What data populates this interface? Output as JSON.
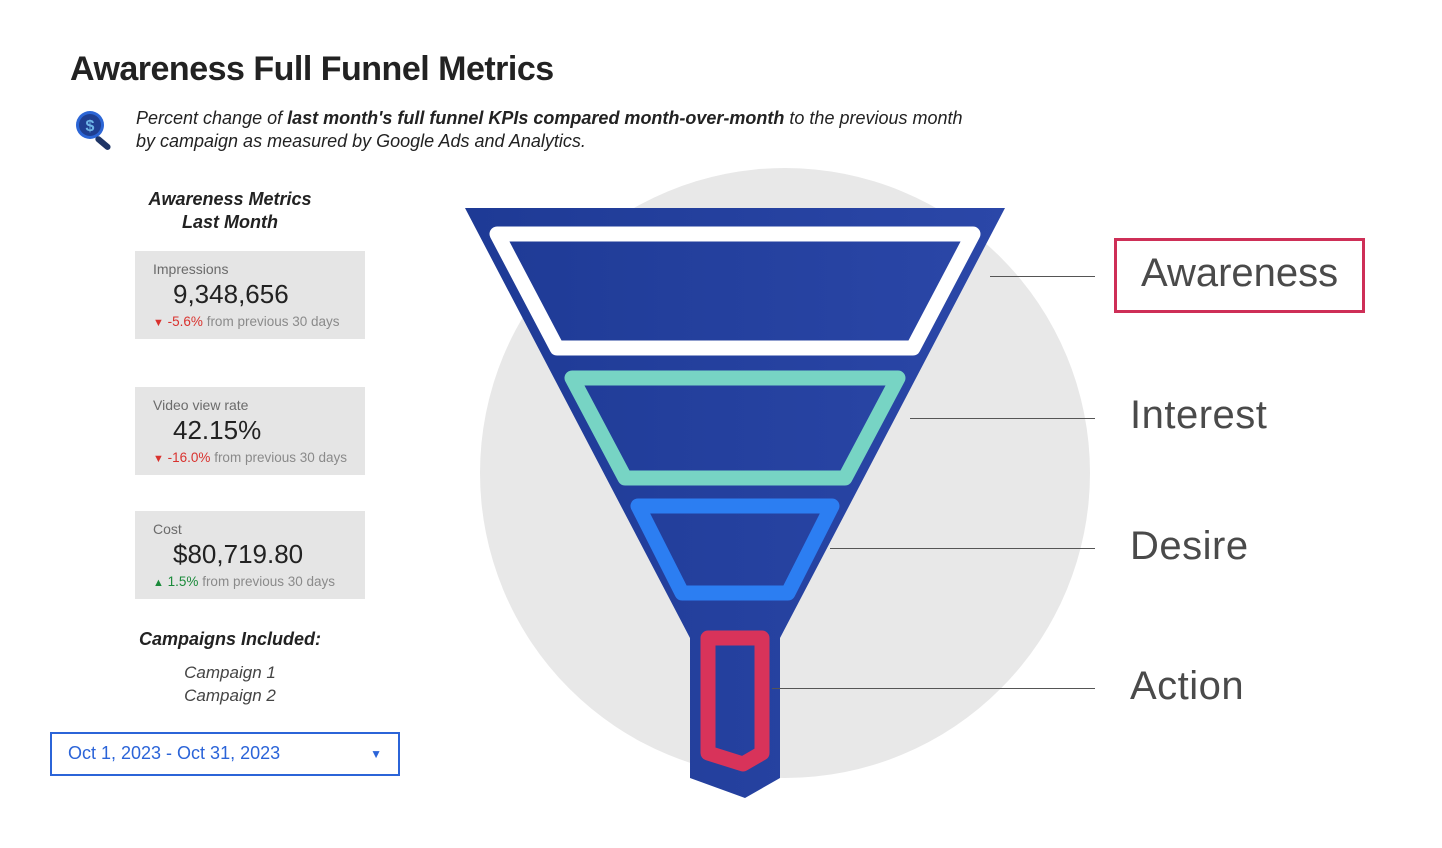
{
  "title": "Awareness Full Funnel Metrics",
  "subtitle_pre": "Percent change of ",
  "subtitle_bold": "last month's full funnel KPIs compared month-over-month",
  "subtitle_post": " to the previous month by campaign as measured by Google Ads and Analytics.",
  "metrics_heading_line1": "Awareness Metrics",
  "metrics_heading_line2": "Last Month",
  "metrics": [
    {
      "label": "Impressions",
      "value": "9,348,656",
      "direction": "down",
      "pct": "-5.6%",
      "suffix": " from previous 30 days"
    },
    {
      "label": "Video view rate",
      "value": "42.15%",
      "direction": "down",
      "pct": "-16.0%",
      "suffix": " from previous 30 days"
    },
    {
      "label": "Cost",
      "value": "$80,719.80",
      "direction": "up",
      "pct": "1.5%",
      "suffix": " from previous 30 days"
    }
  ],
  "campaigns_heading": "Campaigns Included:",
  "campaigns": [
    "Campaign 1",
    "Campaign 2"
  ],
  "date_range": "Oct 1, 2023 - Oct 31, 2023",
  "funnel_stages": [
    "Awareness",
    "Interest",
    "Desire",
    "Action"
  ],
  "highlighted_stage": "Awareness",
  "colors": {
    "funnel_body": "#2a3f93",
    "stage1_ring": "#ffffff",
    "stage2_ring": "#77d4c4",
    "stage3_ring": "#2c7ef2",
    "stage4_ring": "#d8335a",
    "highlight": "#ce2f57",
    "accent_blue": "#2b64d8"
  }
}
